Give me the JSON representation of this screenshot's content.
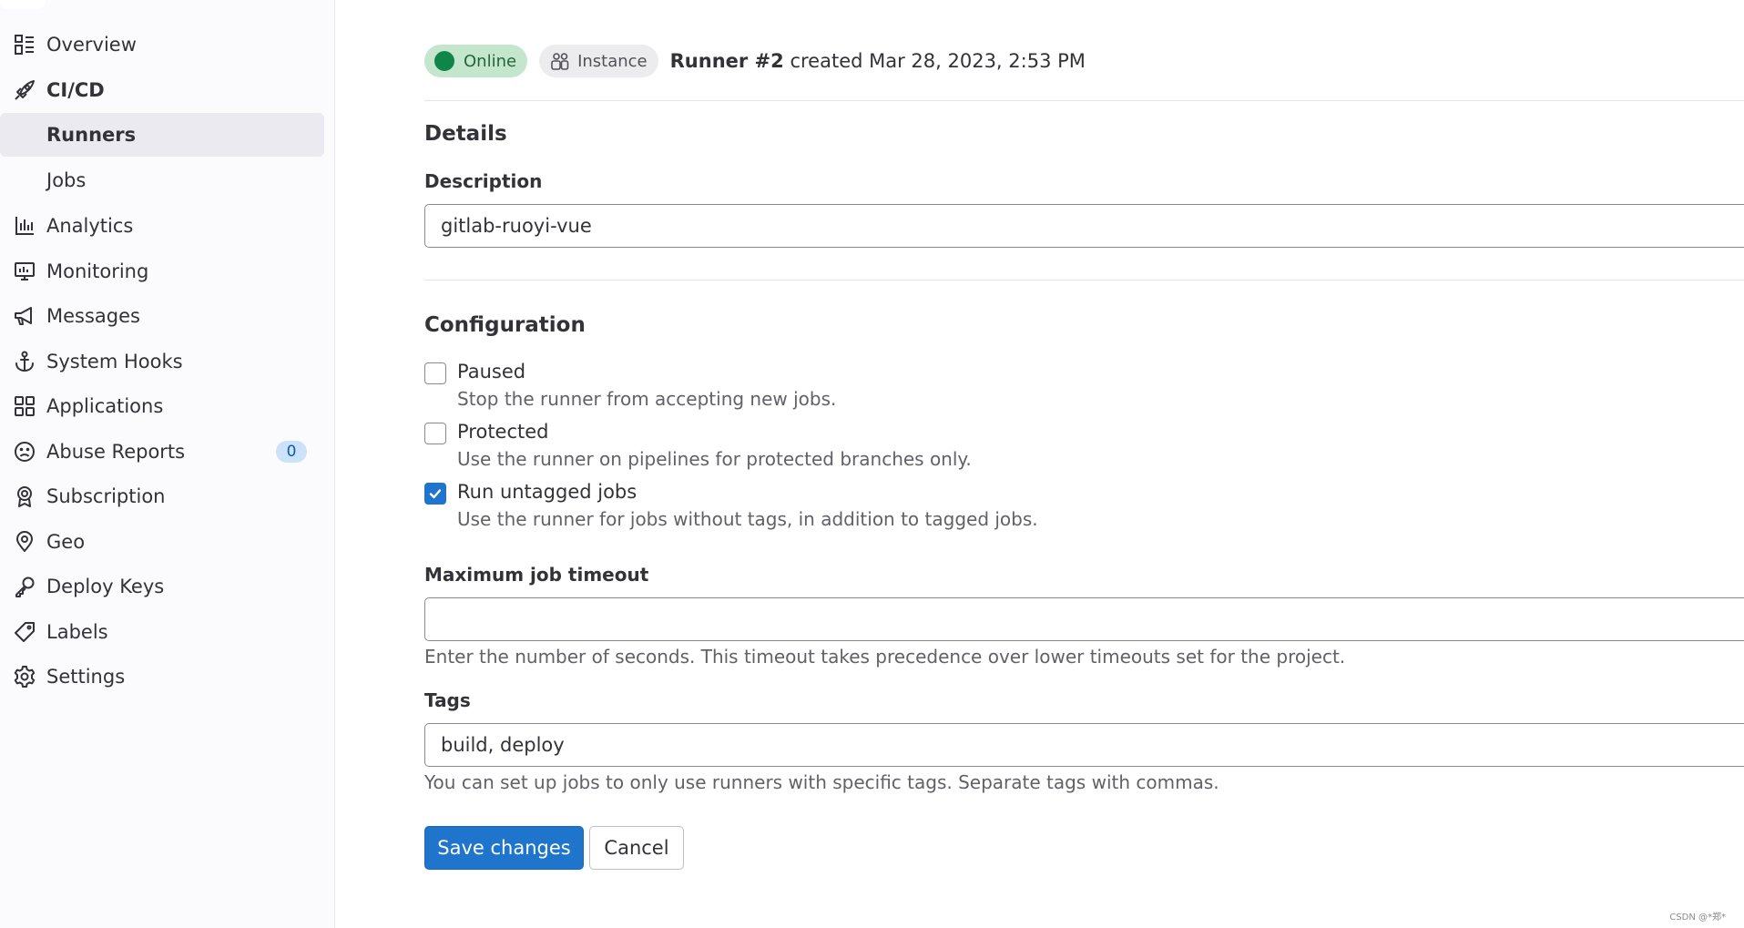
{
  "sidebar": {
    "items": [
      {
        "label": "Overview",
        "icon": "overview-icon"
      },
      {
        "label": "CI/CD",
        "icon": "rocket-icon"
      },
      {
        "label": "Runners"
      },
      {
        "label": "Jobs"
      },
      {
        "label": "Analytics",
        "icon": "chart-icon"
      },
      {
        "label": "Monitoring",
        "icon": "monitor-icon"
      },
      {
        "label": "Messages",
        "icon": "megaphone-icon"
      },
      {
        "label": "System Hooks",
        "icon": "anchor-icon"
      },
      {
        "label": "Applications",
        "icon": "grid-icon"
      },
      {
        "label": "Abuse Reports",
        "icon": "frown-icon",
        "badge": "0"
      },
      {
        "label": "Subscription",
        "icon": "ribbon-icon"
      },
      {
        "label": "Geo",
        "icon": "location-pin-icon"
      },
      {
        "label": "Deploy Keys",
        "icon": "key-icon"
      },
      {
        "label": "Labels",
        "icon": "label-tag-icon"
      },
      {
        "label": "Settings",
        "icon": "gear-icon"
      }
    ]
  },
  "runner": {
    "status": "Online",
    "type": "Instance",
    "name": "Runner #2",
    "created": "created Mar 28, 2023, 2:53 PM"
  },
  "details": {
    "title": "Details",
    "description_label": "Description",
    "description_value": "gitlab-ruoyi-vue"
  },
  "configuration": {
    "title": "Configuration",
    "options": [
      {
        "label": "Paused",
        "help": "Stop the runner from accepting new jobs.",
        "checked": false
      },
      {
        "label": "Protected",
        "help": "Use the runner on pipelines for protected branches only.",
        "checked": false
      },
      {
        "label": "Run untagged jobs",
        "help": "Use the runner for jobs without tags, in addition to tagged jobs.",
        "checked": true
      }
    ],
    "timeout_label": "Maximum job timeout",
    "timeout_value": "",
    "timeout_help": "Enter the number of seconds. This timeout takes precedence over lower timeouts set for the project.",
    "tags_label": "Tags",
    "tags_value": "build, deploy",
    "tags_help": "You can set up jobs to only use runners with specific tags. Separate tags with commas."
  },
  "actions": {
    "save_label": "Save changes",
    "cancel_label": "Cancel"
  },
  "watermark": "CSDN @*郑*",
  "colors": {
    "primary": "#1f75cb",
    "online_bg": "#c3e6cd",
    "online_dot": "#108548",
    "badge_bg": "#cbe2f9"
  }
}
